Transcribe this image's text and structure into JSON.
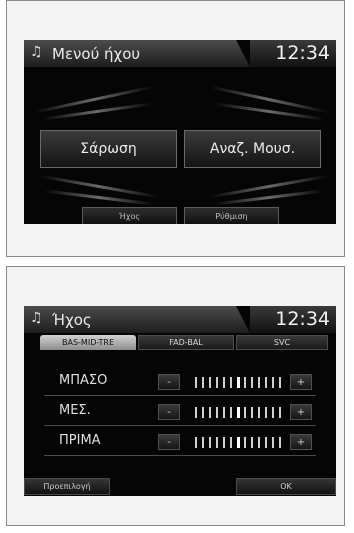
{
  "audio_menu": {
    "title": "Μενού ήχου",
    "time": "12:34",
    "scan_label": "Σάρωση",
    "music_search_label": "Αναζ. Μουσ.",
    "sound_label": "Ήχος",
    "setup_label": "Ρύθμιση",
    "note_icon": "music-note-icon"
  },
  "sound_screen": {
    "title": "Ήχος",
    "time": "12:34",
    "tabs": [
      {
        "label": "BAS-MID-TRE",
        "active": true
      },
      {
        "label": "FAD-BAL",
        "active": false
      },
      {
        "label": "SVC",
        "active": false
      }
    ],
    "rows": [
      {
        "label": "ΜΠΑΣΟ",
        "minus": "-",
        "plus": "+",
        "level": 0
      },
      {
        "label": "ΜΕΣ.",
        "minus": "-",
        "plus": "+",
        "level": 0
      },
      {
        "label": "ΠΡΙΜΑ",
        "minus": "-",
        "plus": "+",
        "level": 0
      }
    ],
    "default_label": "Προεπιλογή",
    "ok_label": "OK"
  }
}
